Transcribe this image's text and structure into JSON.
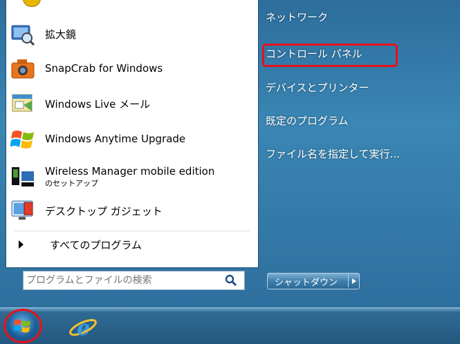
{
  "programs": [
    {
      "label": "拡大鏡",
      "icon": "magnifier-icon"
    },
    {
      "label": "SnapCrab for Windows",
      "icon": "camera-icon"
    },
    {
      "label": "Windows Live メール",
      "icon": "mail-icon"
    },
    {
      "label": "Windows Anytime Upgrade",
      "icon": "windows-flag-icon"
    },
    {
      "label": "Wireless Manager mobile edition",
      "sublabel": "のセットアップ",
      "icon": "wireless-manager-icon"
    },
    {
      "label": "デスクトップ ガジェット",
      "icon": "gadget-icon"
    }
  ],
  "all_programs": "すべてのプログラム",
  "search": {
    "placeholder": "プログラムとファイルの検索"
  },
  "right_pane": {
    "network": "ネットワーク",
    "control_panel": "コントロール パネル",
    "devices": "デバイスとプリンター",
    "default_programs": "既定のプログラム",
    "run": "ファイル名を指定して実行..."
  },
  "shutdown": {
    "label": "シャットダウン"
  },
  "colors": {
    "highlight": "#e8101a",
    "menu_blue": "#3a86b4"
  }
}
